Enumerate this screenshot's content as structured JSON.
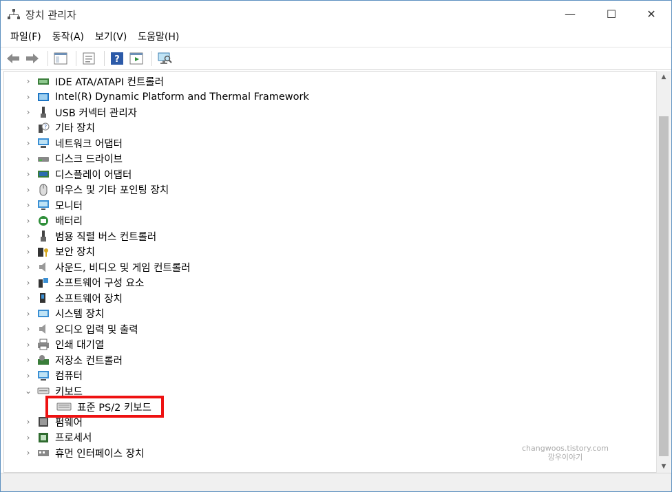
{
  "window": {
    "title": "장치 관리자",
    "controls": {
      "minimize": "—",
      "maximize": "☐",
      "close": "✕"
    }
  },
  "menu": [
    {
      "label": "파일(F)"
    },
    {
      "label": "동작(A)"
    },
    {
      "label": "보기(V)"
    },
    {
      "label": "도움말(H)"
    }
  ],
  "toolbar": {
    "buttons": [
      "back-icon",
      "forward-icon",
      "show-hide-console-tree-icon",
      "properties-icon",
      "help-icon",
      "action-pane-icon",
      "scan-hardware-icon"
    ]
  },
  "tree": {
    "items": [
      {
        "label": "IDE ATA/ATAPI 컨트롤러",
        "icon": "ide-controller-icon",
        "expanded": false
      },
      {
        "label": "Intel(R) Dynamic Platform and Thermal Framework",
        "icon": "intel-framework-icon",
        "expanded": false
      },
      {
        "label": "USB 커넥터 관리자",
        "icon": "usb-connector-icon",
        "expanded": false
      },
      {
        "label": "기타 장치",
        "icon": "other-device-icon",
        "expanded": false
      },
      {
        "label": "네트워크 어댑터",
        "icon": "network-adapter-icon",
        "expanded": false
      },
      {
        "label": "디스크 드라이브",
        "icon": "disk-drive-icon",
        "expanded": false
      },
      {
        "label": "디스플레이 어댑터",
        "icon": "display-adapter-icon",
        "expanded": false
      },
      {
        "label": "마우스 및 기타 포인팅 장치",
        "icon": "mouse-icon",
        "expanded": false
      },
      {
        "label": "모니터",
        "icon": "monitor-icon",
        "expanded": false
      },
      {
        "label": "배터리",
        "icon": "battery-icon",
        "expanded": false
      },
      {
        "label": "범용 직렬 버스 컨트롤러",
        "icon": "usb-controller-icon",
        "expanded": false
      },
      {
        "label": "보안 장치",
        "icon": "security-device-icon",
        "expanded": false
      },
      {
        "label": "사운드, 비디오 및 게임 컨트롤러",
        "icon": "sound-icon",
        "expanded": false
      },
      {
        "label": "소프트웨어 구성 요소",
        "icon": "software-component-icon",
        "expanded": false
      },
      {
        "label": "소프트웨어 장치",
        "icon": "software-device-icon",
        "expanded": false
      },
      {
        "label": "시스템 장치",
        "icon": "system-device-icon",
        "expanded": false
      },
      {
        "label": "오디오 입력 및 출력",
        "icon": "audio-io-icon",
        "expanded": false
      },
      {
        "label": "인쇄 대기열",
        "icon": "print-queue-icon",
        "expanded": false
      },
      {
        "label": "저장소 컨트롤러",
        "icon": "storage-controller-icon",
        "expanded": false
      },
      {
        "label": "컴퓨터",
        "icon": "computer-icon",
        "expanded": false
      },
      {
        "label": "키보드",
        "icon": "keyboard-icon",
        "expanded": true
      },
      {
        "label": "펌웨어",
        "icon": "firmware-icon",
        "expanded": false
      },
      {
        "label": "프로세서",
        "icon": "processor-icon",
        "expanded": false
      },
      {
        "label": "휴먼 인터페이스 장치",
        "icon": "hid-icon",
        "expanded": false
      }
    ],
    "keyboard_child": {
      "label": "표준 PS/2 키보드",
      "icon": "keyboard-device-icon"
    }
  },
  "watermark": {
    "line1": "changwoos.tistory.com",
    "line2": "깡우이야기"
  },
  "colors": {
    "highlight_border": "#ee1111",
    "window_border": "#5b8fbf"
  }
}
